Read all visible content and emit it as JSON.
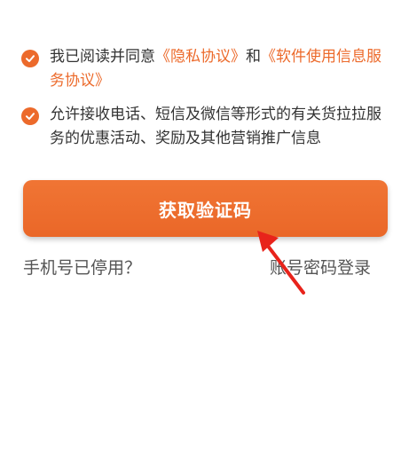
{
  "agreement": {
    "prefix": "我已阅读并同意",
    "privacy_link": "《隐私协议》",
    "conjunction": "和",
    "terms_link": "《软件使用信息服务协议》"
  },
  "marketing": {
    "text": "允许接收电话、短信及微信等形式的有关货拉拉服务的优惠活动、奖励及其他营销推广信息"
  },
  "primary_button": {
    "label": "获取验证码"
  },
  "links": {
    "phone_disabled": "手机号已停用？",
    "password_login": "账号密码登录"
  },
  "colors": {
    "accent": "#ec6a2b",
    "annotation_arrow": "#e8231b"
  }
}
